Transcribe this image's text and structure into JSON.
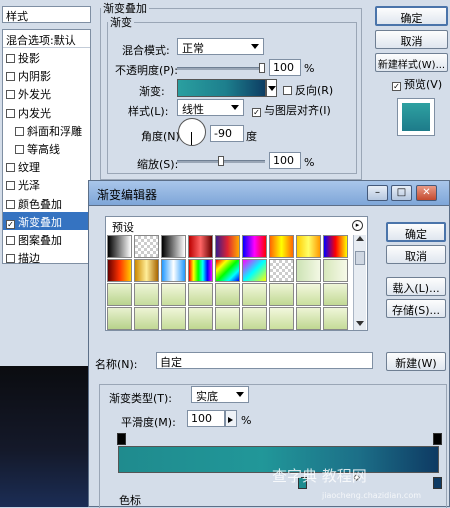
{
  "styles_panel": {
    "header": "样式",
    "blend_options": "混合选项:默认",
    "items": [
      {
        "label": "投影",
        "checked": false,
        "selected": false
      },
      {
        "label": "内阴影",
        "checked": false,
        "selected": false
      },
      {
        "label": "外发光",
        "checked": false,
        "selected": false
      },
      {
        "label": "内发光",
        "checked": false,
        "selected": false
      },
      {
        "label": "斜面和浮雕",
        "checked": false,
        "selected": false
      },
      {
        "label": "等高线",
        "checked": false,
        "selected": false
      },
      {
        "label": "纹理",
        "checked": false,
        "selected": false
      },
      {
        "label": "光泽",
        "checked": false,
        "selected": false
      },
      {
        "label": "颜色叠加",
        "checked": false,
        "selected": false
      },
      {
        "label": "渐变叠加",
        "checked": true,
        "selected": true
      },
      {
        "label": "图案叠加",
        "checked": false,
        "selected": false
      },
      {
        "label": "描边",
        "checked": false,
        "selected": false
      }
    ]
  },
  "gradient_overlay": {
    "group_title": "渐变叠加",
    "subgroup_title": "渐变",
    "blend_mode_label": "混合模式:",
    "blend_mode_value": "正常",
    "opacity_label": "不透明度(P):",
    "opacity_value": "100",
    "opacity_unit": "%",
    "opacity_fraction": 1.0,
    "gradient_label": "渐变:",
    "reverse_label": "反向(R)",
    "reverse_checked": false,
    "style_label": "样式(L):",
    "style_value": "线性",
    "align_label": "与图层对齐(I)",
    "align_checked": true,
    "angle_label": "角度(N):",
    "angle_value": "-90",
    "angle_unit": "度",
    "scale_label": "缩放(S):",
    "scale_value": "100",
    "scale_unit": "%",
    "scale_fraction": 0.5
  },
  "right_buttons": {
    "ok": "确定",
    "cancel": "取消",
    "new_style": "新建样式(W)...",
    "preview_label": "预览(V)",
    "preview_checked": true
  },
  "gradient_editor": {
    "title": "渐变编辑器",
    "presets_label": "预设",
    "ok": "确定",
    "cancel": "取消",
    "load": "载入(L)...",
    "save": "存储(S)...",
    "name_label": "名称(N):",
    "name_value": "自定",
    "new_button": "新建(W)",
    "type_label": "渐变类型(T):",
    "type_value": "实底",
    "smooth_label": "平滑度(M):",
    "smooth_value": "100",
    "smooth_unit": "%",
    "stops_label": "色标"
  },
  "watermark": {
    "main": "查字典 教程网",
    "sub": "jiaocheng.chazidian.com"
  },
  "colors": {
    "accent_teal": "#219799",
    "deep_blue": "#0e3a63",
    "selection_blue": "#3573c1"
  }
}
